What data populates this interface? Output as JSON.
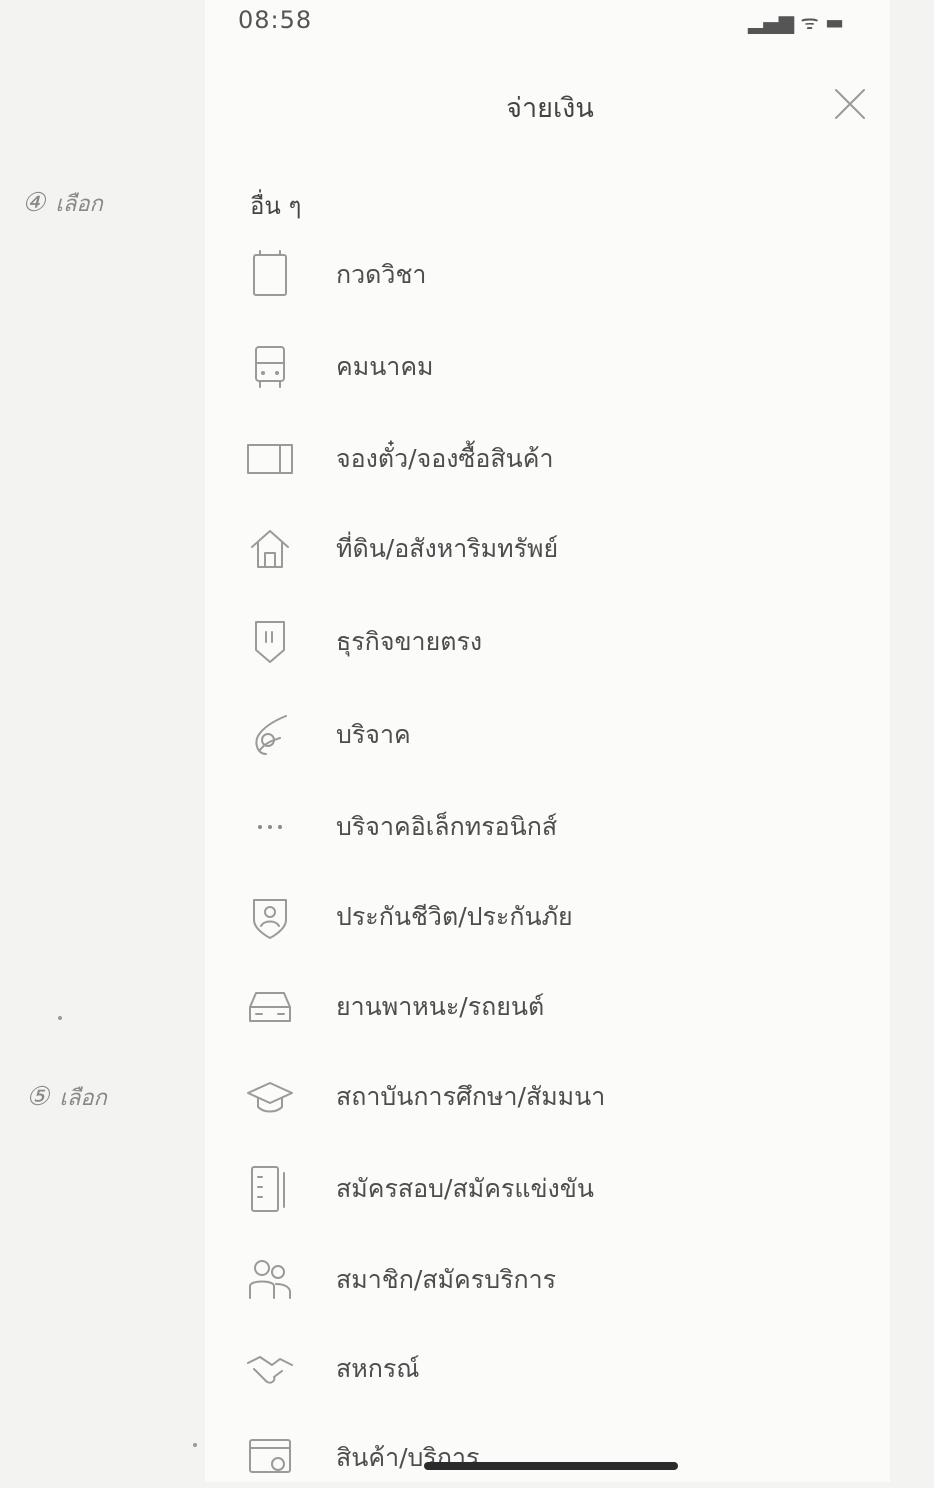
{
  "status_bar": {
    "time": "08:58",
    "indicators": "▂▄▆ ᯤ ▬"
  },
  "header": {
    "title": "จ่ายเงิน"
  },
  "section": {
    "label": "อื่น ๆ"
  },
  "items": [
    {
      "label": "กวดวิชา",
      "icon": "notebook-icon"
    },
    {
      "label": "คมนาคม",
      "icon": "bus-icon"
    },
    {
      "label": "จองตั๋ว/จองซื้อสินค้า",
      "icon": "ticket-icon"
    },
    {
      "label": "ที่ดิน/อสังหาริมทรัพย์",
      "icon": "house-icon"
    },
    {
      "label": "ธุรกิจขายตรง",
      "icon": "shopping-bag-icon"
    },
    {
      "label": "บริจาค",
      "icon": "donate-hand-icon"
    },
    {
      "label": "บริจาคอิเล็กทรอนิกส์",
      "icon": "more-dots-icon"
    },
    {
      "label": "ประกันชีวิต/ประกันภัย",
      "icon": "shield-person-icon"
    },
    {
      "label": "ยานพาหนะ/รถยนต์",
      "icon": "car-icon"
    },
    {
      "label": "สถาบันการศึกษา/สัมมนา",
      "icon": "graduation-cap-icon"
    },
    {
      "label": "สมัครสอบ/สมัครแข่งขัน",
      "icon": "form-icon"
    },
    {
      "label": "สมาชิก/สมัครบริการ",
      "icon": "members-icon"
    },
    {
      "label": "สหกรณ์",
      "icon": "handshake-icon"
    },
    {
      "label": "สินค้า/บริการ",
      "icon": "product-icon"
    }
  ],
  "annotations": [
    {
      "number": "④",
      "word": "เลือก"
    },
    {
      "number": "⑤",
      "word": "เลือก"
    }
  ]
}
